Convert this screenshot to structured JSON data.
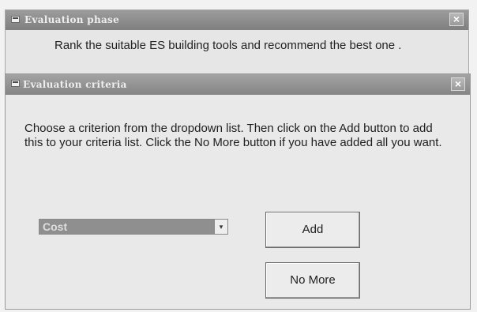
{
  "outer_window": {
    "title": "Evaluation phase",
    "close_glyph": "×",
    "message": "Rank the suitable ES building tools and recommend the best one ."
  },
  "dialog": {
    "title": "Evaluation criteria",
    "close_glyph": "×",
    "instructions": "Choose a criterion from the dropdown list. Then click on the Add button to add this to your criteria list. Click the No More button if you have added all you want.",
    "criterion_select": {
      "selected_value": "Cost",
      "arrow_glyph": "▾"
    },
    "add_label": "Add",
    "no_more_label": "No More"
  }
}
